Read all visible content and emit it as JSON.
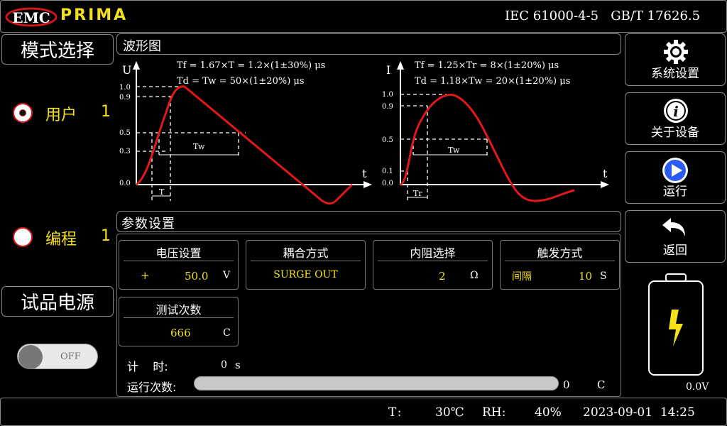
{
  "header": {
    "logo_emc": "EMC",
    "brand": "PRIMA",
    "standards": "IEC 61000-4-5   GB/T 17626.5"
  },
  "left": {
    "mode_title": "模式选择",
    "user_label": "用户",
    "user_num": "1",
    "program_label": "编程",
    "program_num": "1",
    "power_title": "试品电源",
    "toggle_label": "OFF"
  },
  "waveform": {
    "title": "波形图",
    "left": {
      "y_axis": "U",
      "x_axis": "t",
      "formula1": "Tf = 1.67×T = 1.2×(1±30%) μs",
      "formula2": "Td = Tw = 50×(1±20%) μs",
      "ticks": [
        "1.0",
        "0.9",
        "0.5",
        "0.3",
        "0.0"
      ],
      "t_label": "T",
      "tw_label": "Tw"
    },
    "right": {
      "y_axis": "I",
      "x_axis": "t",
      "formula1": "Tf = 1.25×Tr = 8×(1±20%) μs",
      "formula2": "Td = 1.18×Tw = 20×(1±20%) μs",
      "ticks": [
        "1.0",
        "0.9",
        "0.5",
        "0.1",
        "0.0"
      ],
      "t_label": "Tr",
      "tw_label": "Tw"
    }
  },
  "params": {
    "title": "参数设置",
    "voltage": {
      "title": "电压设置",
      "sign": "+",
      "value": "50.0",
      "unit": "V"
    },
    "coupling": {
      "title": "耦合方式",
      "value": "SURGE OUT"
    },
    "impedance": {
      "title": "内阻选择",
      "value": "2",
      "unit": "Ω"
    },
    "trigger": {
      "title": "触发方式",
      "mode": "间隔",
      "value": "10",
      "unit": "S"
    },
    "count": {
      "title": "测试次数",
      "value": "666",
      "unit": "C"
    },
    "timer_label": "计    时:",
    "timer_value": "0",
    "timer_unit": "s",
    "run_label": "运行次数:",
    "run_value": "0",
    "run_unit": "C",
    "run_progress": 0
  },
  "right": {
    "settings": "系统设置",
    "about": "关于设备",
    "run": "运行",
    "back": "返回",
    "battery_voltage": "0.0V"
  },
  "status": {
    "temp_label": "T:",
    "temp_value": "30℃",
    "rh_label": "RH:",
    "rh_value": "40%",
    "datetime": "2023-09-01  14:25"
  },
  "colors": {
    "accent": "#f5e11a",
    "curve": "#e01818",
    "run_blue": "#2a5cf0"
  }
}
